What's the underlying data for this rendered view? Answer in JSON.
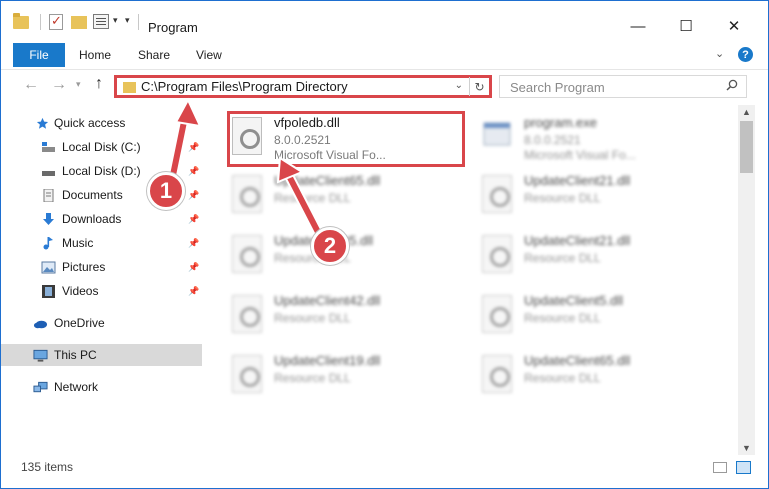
{
  "window": {
    "title": "Program",
    "controls": {
      "minimize": "—",
      "maximize": "☐",
      "close": "✕"
    }
  },
  "ribbon": {
    "tabs": [
      "File",
      "Home",
      "Share",
      "View"
    ],
    "help": "?"
  },
  "nav": {
    "address": "C:\\Program Files\\Program Directory",
    "search_placeholder": "Search Program"
  },
  "sidebar": {
    "items": [
      {
        "label": "Quick access"
      },
      {
        "label": "Local Disk (C:)"
      },
      {
        "label": "Local Disk (D:)"
      },
      {
        "label": "Documents"
      },
      {
        "label": "Downloads"
      },
      {
        "label": "Music"
      },
      {
        "label": "Pictures"
      },
      {
        "label": "Videos"
      },
      {
        "label": "OneDrive"
      },
      {
        "label": "This PC"
      },
      {
        "label": "Network"
      }
    ]
  },
  "files": [
    {
      "name": "vfpoledb.dll",
      "line2": "8.0.0.2521",
      "line3": "Microsoft Visual Fo..."
    },
    {
      "name": "program.exe",
      "line2": "8.0.0.2521",
      "line3": "Microsoft Visual Fo..."
    },
    {
      "name": "UpdateClient65.dll",
      "line2": "Resource DLL"
    },
    {
      "name": "UpdateClient21.dll",
      "line2": "Resource DLL"
    },
    {
      "name": "UpdateClient5.dll",
      "line2": "Resource DLL"
    },
    {
      "name": "UpdateClient21.dll",
      "line2": "Resource DLL"
    },
    {
      "name": "UpdateClient42.dll",
      "line2": "Resource DLL"
    },
    {
      "name": "UpdateClient5.dll",
      "line2": "Resource DLL"
    },
    {
      "name": "UpdateClient19.dll",
      "line2": "Resource DLL"
    },
    {
      "name": "UpdateClient65.dll",
      "line2": "Resource DLL"
    }
  ],
  "status": {
    "count": "135 items"
  },
  "callouts": [
    "1",
    "2"
  ],
  "colors": {
    "accent": "#1979ca",
    "highlight": "#d9464a",
    "folder": "#e8c35a"
  }
}
